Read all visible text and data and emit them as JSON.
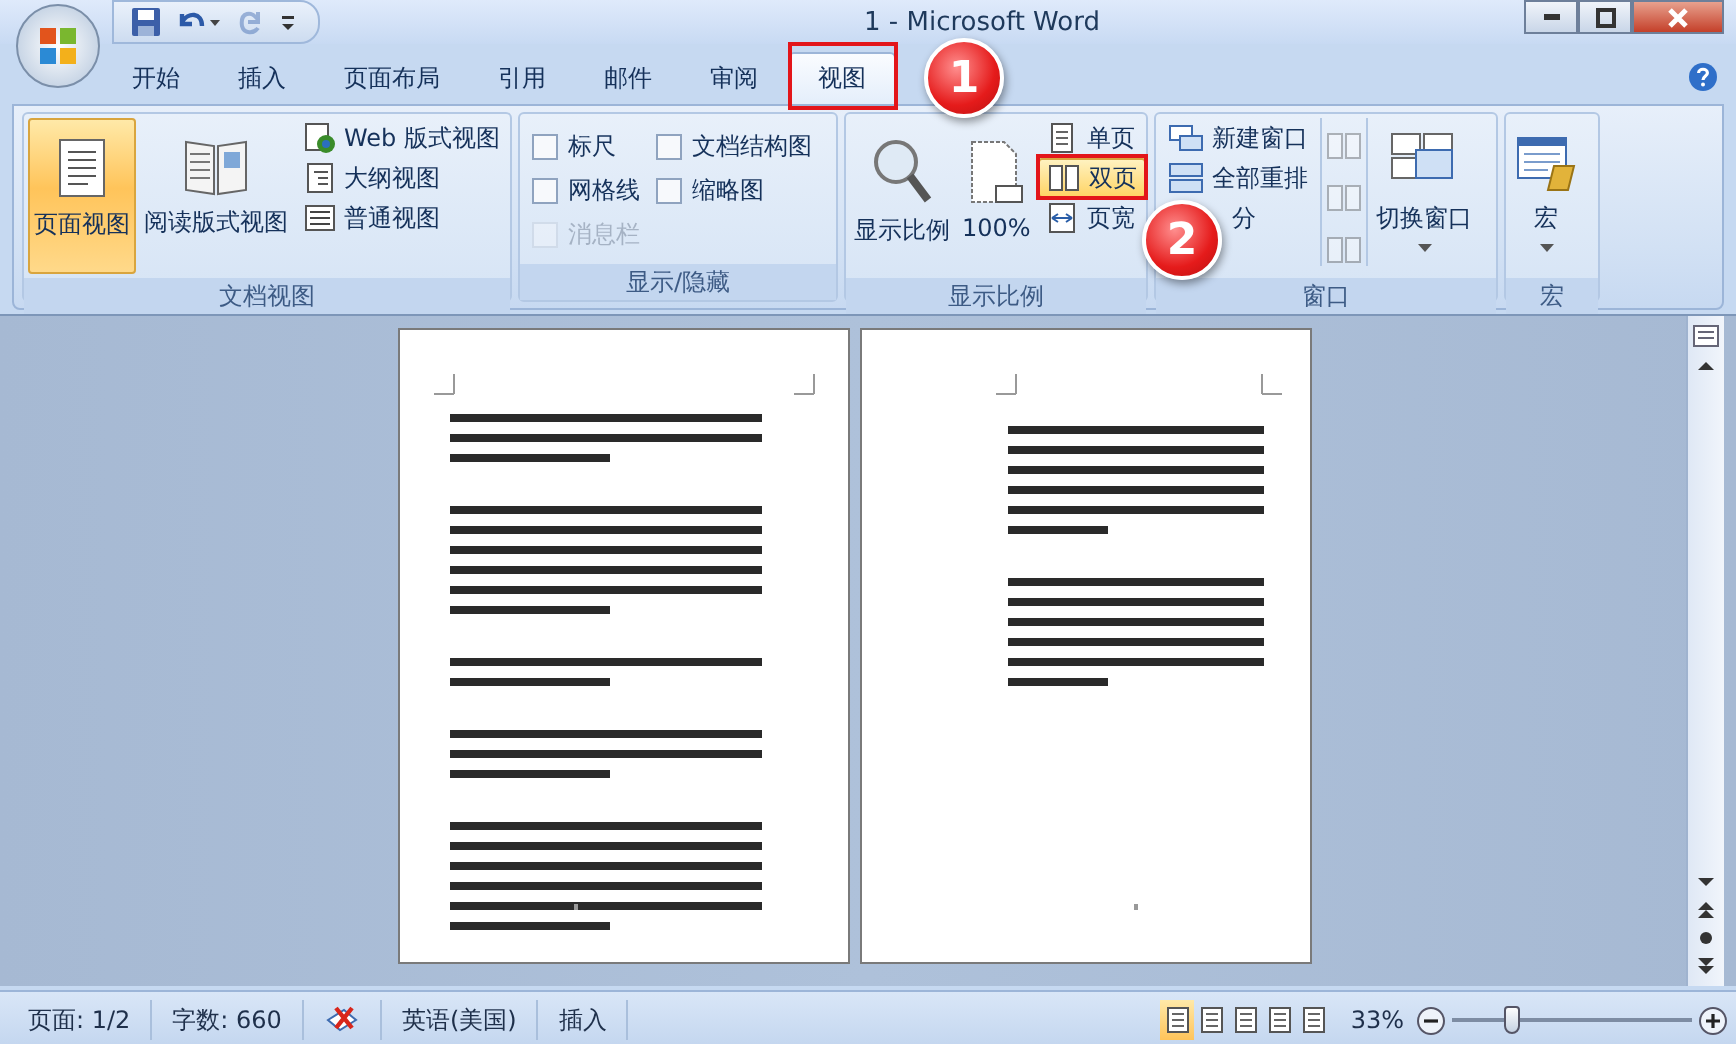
{
  "window": {
    "title": "1 - Microsoft Word"
  },
  "quick_access": [
    {
      "kind": "save",
      "disabled": false
    },
    {
      "kind": "undo",
      "disabled": false
    },
    {
      "kind": "redo",
      "disabled": true
    },
    {
      "kind": "customize",
      "disabled": false
    }
  ],
  "tabs": [
    {
      "label": "开始",
      "selected": false
    },
    {
      "label": "插入",
      "selected": false
    },
    {
      "label": "页面布局",
      "selected": false
    },
    {
      "label": "引用",
      "selected": false
    },
    {
      "label": "邮件",
      "selected": false
    },
    {
      "label": "审阅",
      "selected": false
    },
    {
      "label": "视图",
      "selected": true
    }
  ],
  "ribbon": {
    "groups": [
      {
        "kind": "views",
        "title": "文档视图",
        "large": [
          {
            "label": "页面视图",
            "selected": true
          },
          {
            "label": "阅读版式视图",
            "selected": false
          }
        ],
        "small": [
          {
            "label": "Web 版式视图"
          },
          {
            "label": "大纲视图"
          },
          {
            "label": "普通视图"
          }
        ]
      },
      {
        "kind": "show",
        "title": "显示/隐藏",
        "checkboxes": [
          {
            "label": "标尺",
            "checked": false,
            "disabled": false
          },
          {
            "label": "文档结构图",
            "checked": false,
            "disabled": false
          },
          {
            "label": "网格线",
            "checked": false,
            "disabled": false
          },
          {
            "label": "缩略图",
            "checked": false,
            "disabled": false
          },
          {
            "label": "消息栏",
            "checked": false,
            "disabled": true
          }
        ]
      },
      {
        "kind": "zoom",
        "title": "显示比例",
        "large": [
          {
            "label": "显示比例"
          },
          {
            "label": "100%"
          }
        ],
        "small": [
          {
            "label": "单页",
            "selected": false
          },
          {
            "label": "双页",
            "selected": true
          },
          {
            "label": "页宽",
            "selected": false
          }
        ]
      },
      {
        "kind": "window",
        "title": "窗口",
        "small": [
          {
            "label": "新建窗口"
          },
          {
            "label": "全部重排"
          },
          {
            "label": "分"
          }
        ],
        "icon_buttons": [
          {
            "disabled": true
          },
          {
            "disabled": true
          },
          {
            "disabled": true
          }
        ],
        "large": [
          {
            "label": "切换窗口"
          }
        ]
      },
      {
        "kind": "macro",
        "title": "宏",
        "large": [
          {
            "label": "宏"
          }
        ]
      }
    ]
  },
  "status_bar": {
    "items": [
      {
        "kind": "text",
        "label": "页面: 1/2"
      },
      {
        "kind": "text",
        "label": "字数: 660"
      },
      {
        "kind": "proofing"
      },
      {
        "kind": "text",
        "label": "英语(美国)"
      },
      {
        "kind": "text",
        "label": "插入"
      }
    ],
    "view_buttons": [
      {
        "selected": true
      },
      {
        "selected": false
      },
      {
        "selected": false
      },
      {
        "selected": false
      },
      {
        "selected": false
      }
    ],
    "zoom": {
      "reading": "33%",
      "level": 0.25
    }
  },
  "annotations": [
    {
      "label": "1"
    },
    {
      "label": "2"
    }
  ]
}
